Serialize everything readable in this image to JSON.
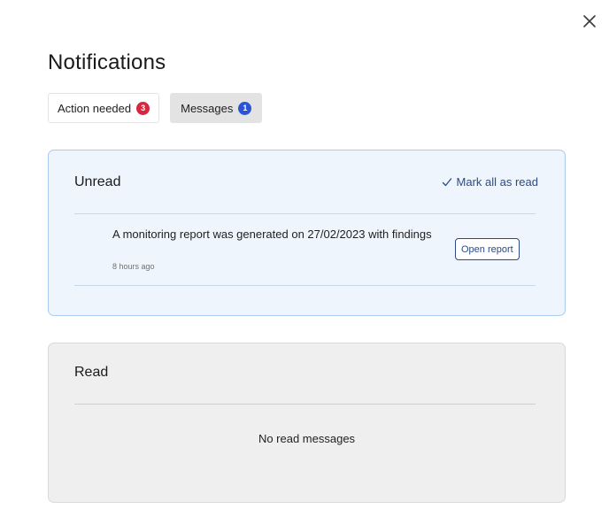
{
  "dialog": {
    "title": "Notifications",
    "close_icon": "close-icon"
  },
  "tabs": [
    {
      "label": "Action needed",
      "count": "3",
      "badge_color": "#d7263d",
      "selected": false
    },
    {
      "label": "Messages",
      "count": "1",
      "badge_color": "#2a53d6",
      "selected": true
    }
  ],
  "unread": {
    "heading": "Unread",
    "mark_all_label": "Mark all as read",
    "mark_all_icon": "check-icon",
    "items": [
      {
        "text": "A monitoring report was generated on 27/02/2023 with findings",
        "time": "8 hours ago",
        "action_label": "Open report"
      }
    ]
  },
  "read": {
    "heading": "Read",
    "empty_text": "No read messages"
  },
  "colors": {
    "accent": "#2b4a86",
    "unread_bg": "#eef5fd",
    "unread_border": "#a9cbee",
    "read_bg": "#efefef"
  }
}
